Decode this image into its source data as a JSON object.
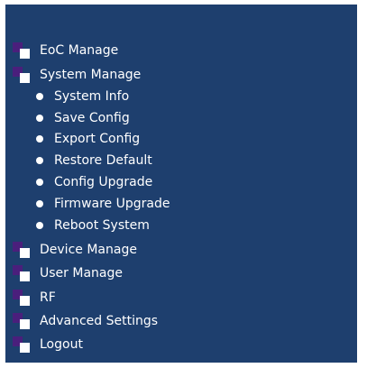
{
  "menu": {
    "items": [
      {
        "label": "EoC Manage",
        "icon": "folder-icon"
      },
      {
        "label": "System Manage",
        "icon": "folder-icon"
      },
      {
        "label": "Device Manage",
        "icon": "folder-icon"
      },
      {
        "label": "User Manage",
        "icon": "folder-icon"
      },
      {
        "label": "RF",
        "icon": "folder-icon"
      },
      {
        "label": "Advanced Settings",
        "icon": "folder-icon"
      },
      {
        "label": "Logout",
        "icon": "folder-icon"
      }
    ],
    "system_manage_subitems": [
      {
        "label": "System Info",
        "icon": "bullet-icon"
      },
      {
        "label": "Save Config",
        "icon": "bullet-icon"
      },
      {
        "label": "Export Config",
        "icon": "bullet-icon"
      },
      {
        "label": "Restore Default",
        "icon": "bullet-icon"
      },
      {
        "label": "Config Upgrade",
        "icon": "bullet-icon"
      },
      {
        "label": "Firmware Upgrade",
        "icon": "bullet-icon"
      },
      {
        "label": "Reboot System",
        "icon": "bullet-icon"
      }
    ]
  },
  "colors": {
    "panel_background": "#1e3f6e",
    "folder_back": "#4a1f7c",
    "folder_front": "#ffffff",
    "text": "#ffffff"
  }
}
